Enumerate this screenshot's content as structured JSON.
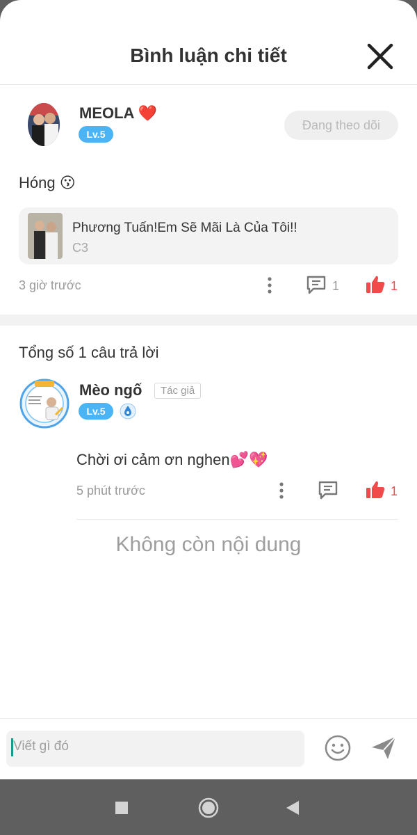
{
  "header": {
    "title": "Bình luận chi tiết"
  },
  "post": {
    "author_name": "MEOLA ❤️",
    "level": "Lv.5",
    "follow_label": "Đang theo dõi",
    "text": "Hóng 😗",
    "quote": {
      "title": "Phương Tuấn!Em Sẽ Mãi Là Của Tôi!!",
      "subtitle": "C3"
    },
    "time": "3 giờ trước",
    "comment_count": "1",
    "like_count": "1"
  },
  "replies_total": "Tổng số 1 câu trả lời",
  "reply": {
    "author_name": "Mèo ngố",
    "author_tag": "Tác giả",
    "level": "Lv.5",
    "text": "Chời ơi cảm ơn nghen💕💖",
    "time": "5 phút trước",
    "like_count": "1"
  },
  "end_message": "Không còn nội dung",
  "composer": {
    "placeholder": "Viết gì đó"
  },
  "colors": {
    "accent_like": "#f04a4a",
    "level_badge": "#4bb4f5",
    "nav_bg": "#5f5f5f"
  },
  "icons": [
    "close-icon",
    "more-vertical-icon",
    "comment-icon",
    "thumbs-up-icon",
    "emoji-icon",
    "send-icon",
    "nav-recent-icon",
    "nav-home-icon",
    "nav-back-icon"
  ]
}
